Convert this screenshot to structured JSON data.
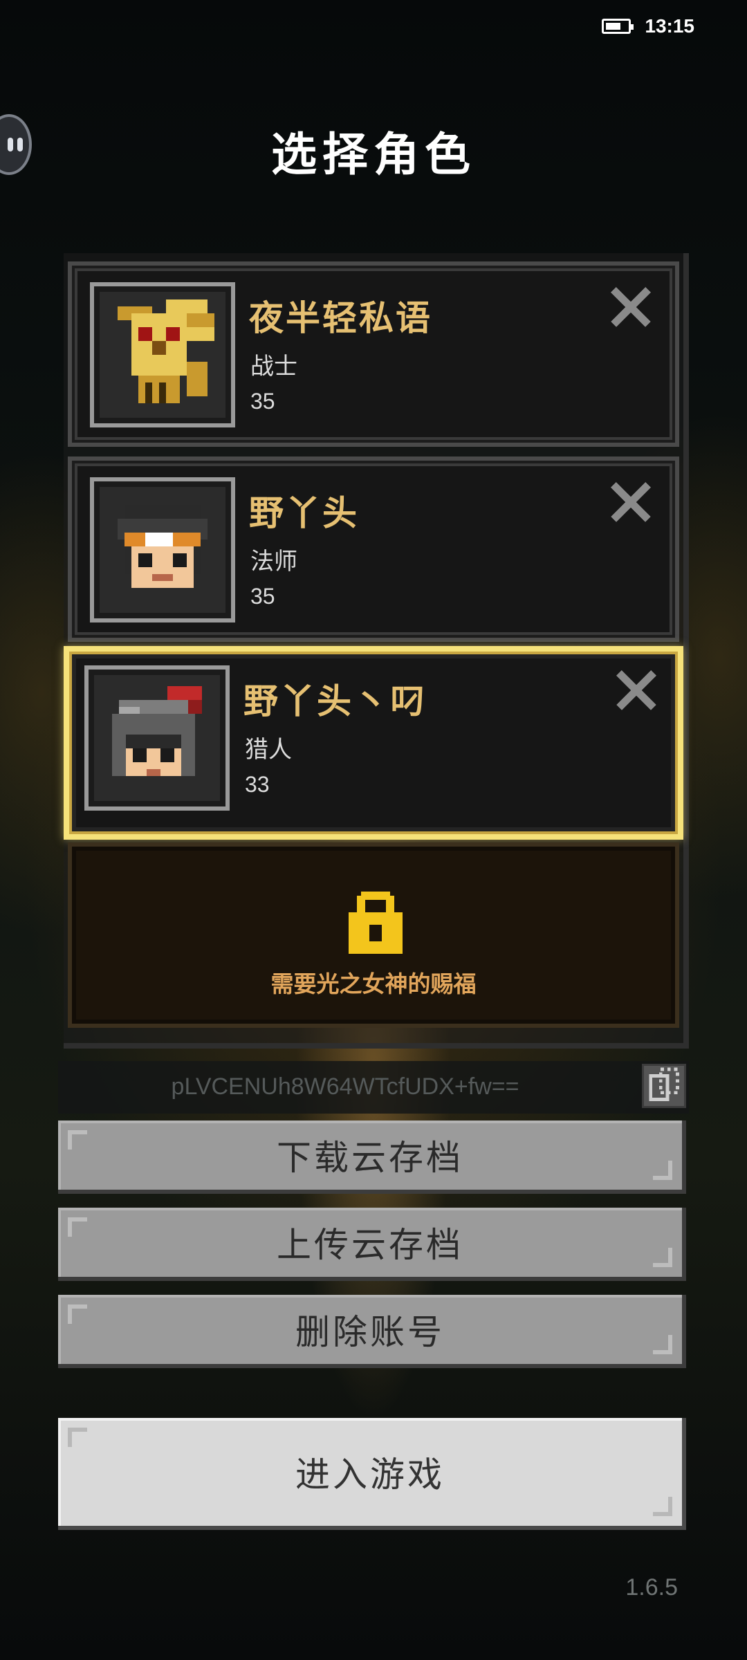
{
  "status_bar": {
    "time": "13:15",
    "battery_level": 0.7
  },
  "screen": {
    "title": "选择角色"
  },
  "characters": [
    {
      "name": "夜半轻私语",
      "class": "战士",
      "level": "35",
      "avatar": "golden-skull-helmet-icon",
      "selected": false
    },
    {
      "name": "野丫头",
      "class": "法师",
      "level": "35",
      "avatar": "mage-portrait-icon",
      "selected": false
    },
    {
      "name": "野丫头丶叼",
      "class": "猎人",
      "level": "33",
      "avatar": "hunter-helmet-portrait-icon",
      "selected": true
    }
  ],
  "locked_slot": {
    "text": "需要光之女神的赐福",
    "icon": "lock-icon"
  },
  "account": {
    "id": "pLVCENUh8W64WTcfUDX+fw==",
    "copy_icon": "copy-icon"
  },
  "buttons": {
    "download": "下载云存档",
    "upload": "上传云存档",
    "delete": "删除账号",
    "enter": "进入游戏"
  },
  "version": "1.6.5",
  "colors": {
    "selected_border": "#f6e27a",
    "name_gold": "#e6c072",
    "lock_yellow": "#f3c51c",
    "lock_text": "#e1a55b"
  }
}
